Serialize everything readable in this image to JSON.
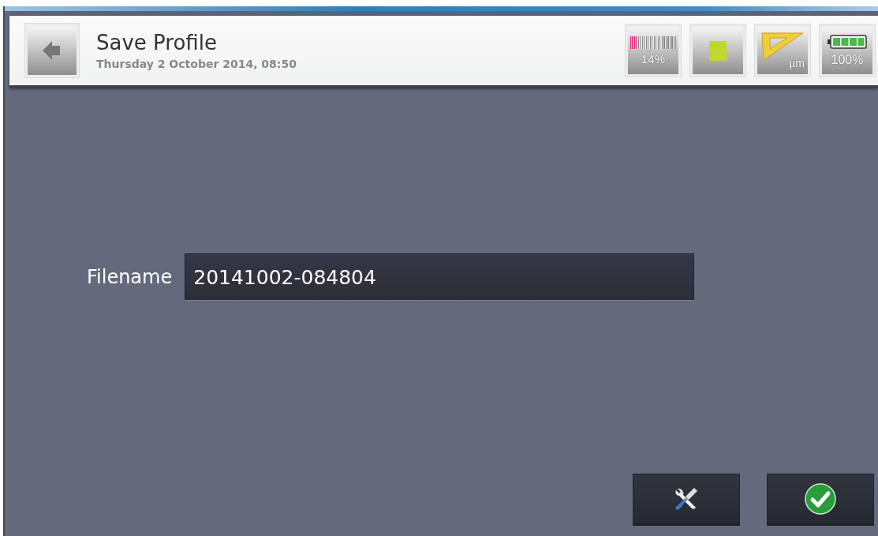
{
  "header": {
    "title": "Save Profile",
    "subtitle": "Thursday 2 October 2014, 08:50"
  },
  "status": {
    "memory": {
      "level": 0.14,
      "reading": "14%"
    },
    "unit": "µm",
    "battery": "100%"
  },
  "form": {
    "label": "Filename",
    "value": "20141002-084804"
  }
}
